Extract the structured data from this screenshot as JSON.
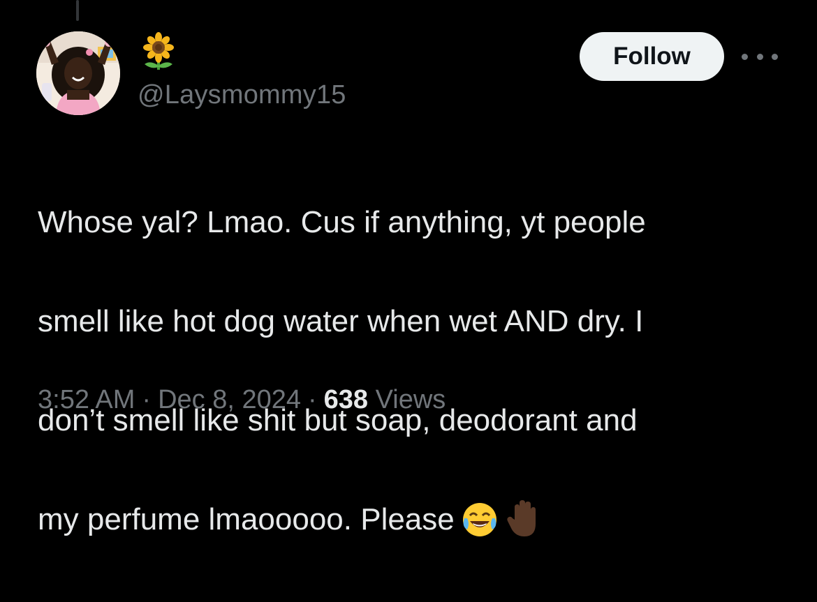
{
  "tweet": {
    "display_name_icon": "sunflower-emoji",
    "handle": "@Laysmommy15",
    "follow_label": "Follow",
    "more_icon": "more-horizontal-icon",
    "text_lines": [
      "Whose yal? Lmao. Cus if anything, yt people",
      "smell like hot dog water when wet AND dry. I",
      "don’t smell like shit but soap, deodorant and",
      "my perfume lmaooooo. Please"
    ],
    "trailing_emojis": [
      "face-with-tears-of-joy-emoji",
      "raised-hand-dark-skin-emoji"
    ],
    "time": "3:52 AM",
    "separator": "·",
    "date": "Dec 8, 2024",
    "views_count": "638",
    "views_label": "Views"
  },
  "colors": {
    "background": "#000000",
    "text_primary": "#e7e9ea",
    "text_secondary": "#71767b",
    "follow_bg": "#eff3f4",
    "follow_text": "#0f1419"
  }
}
